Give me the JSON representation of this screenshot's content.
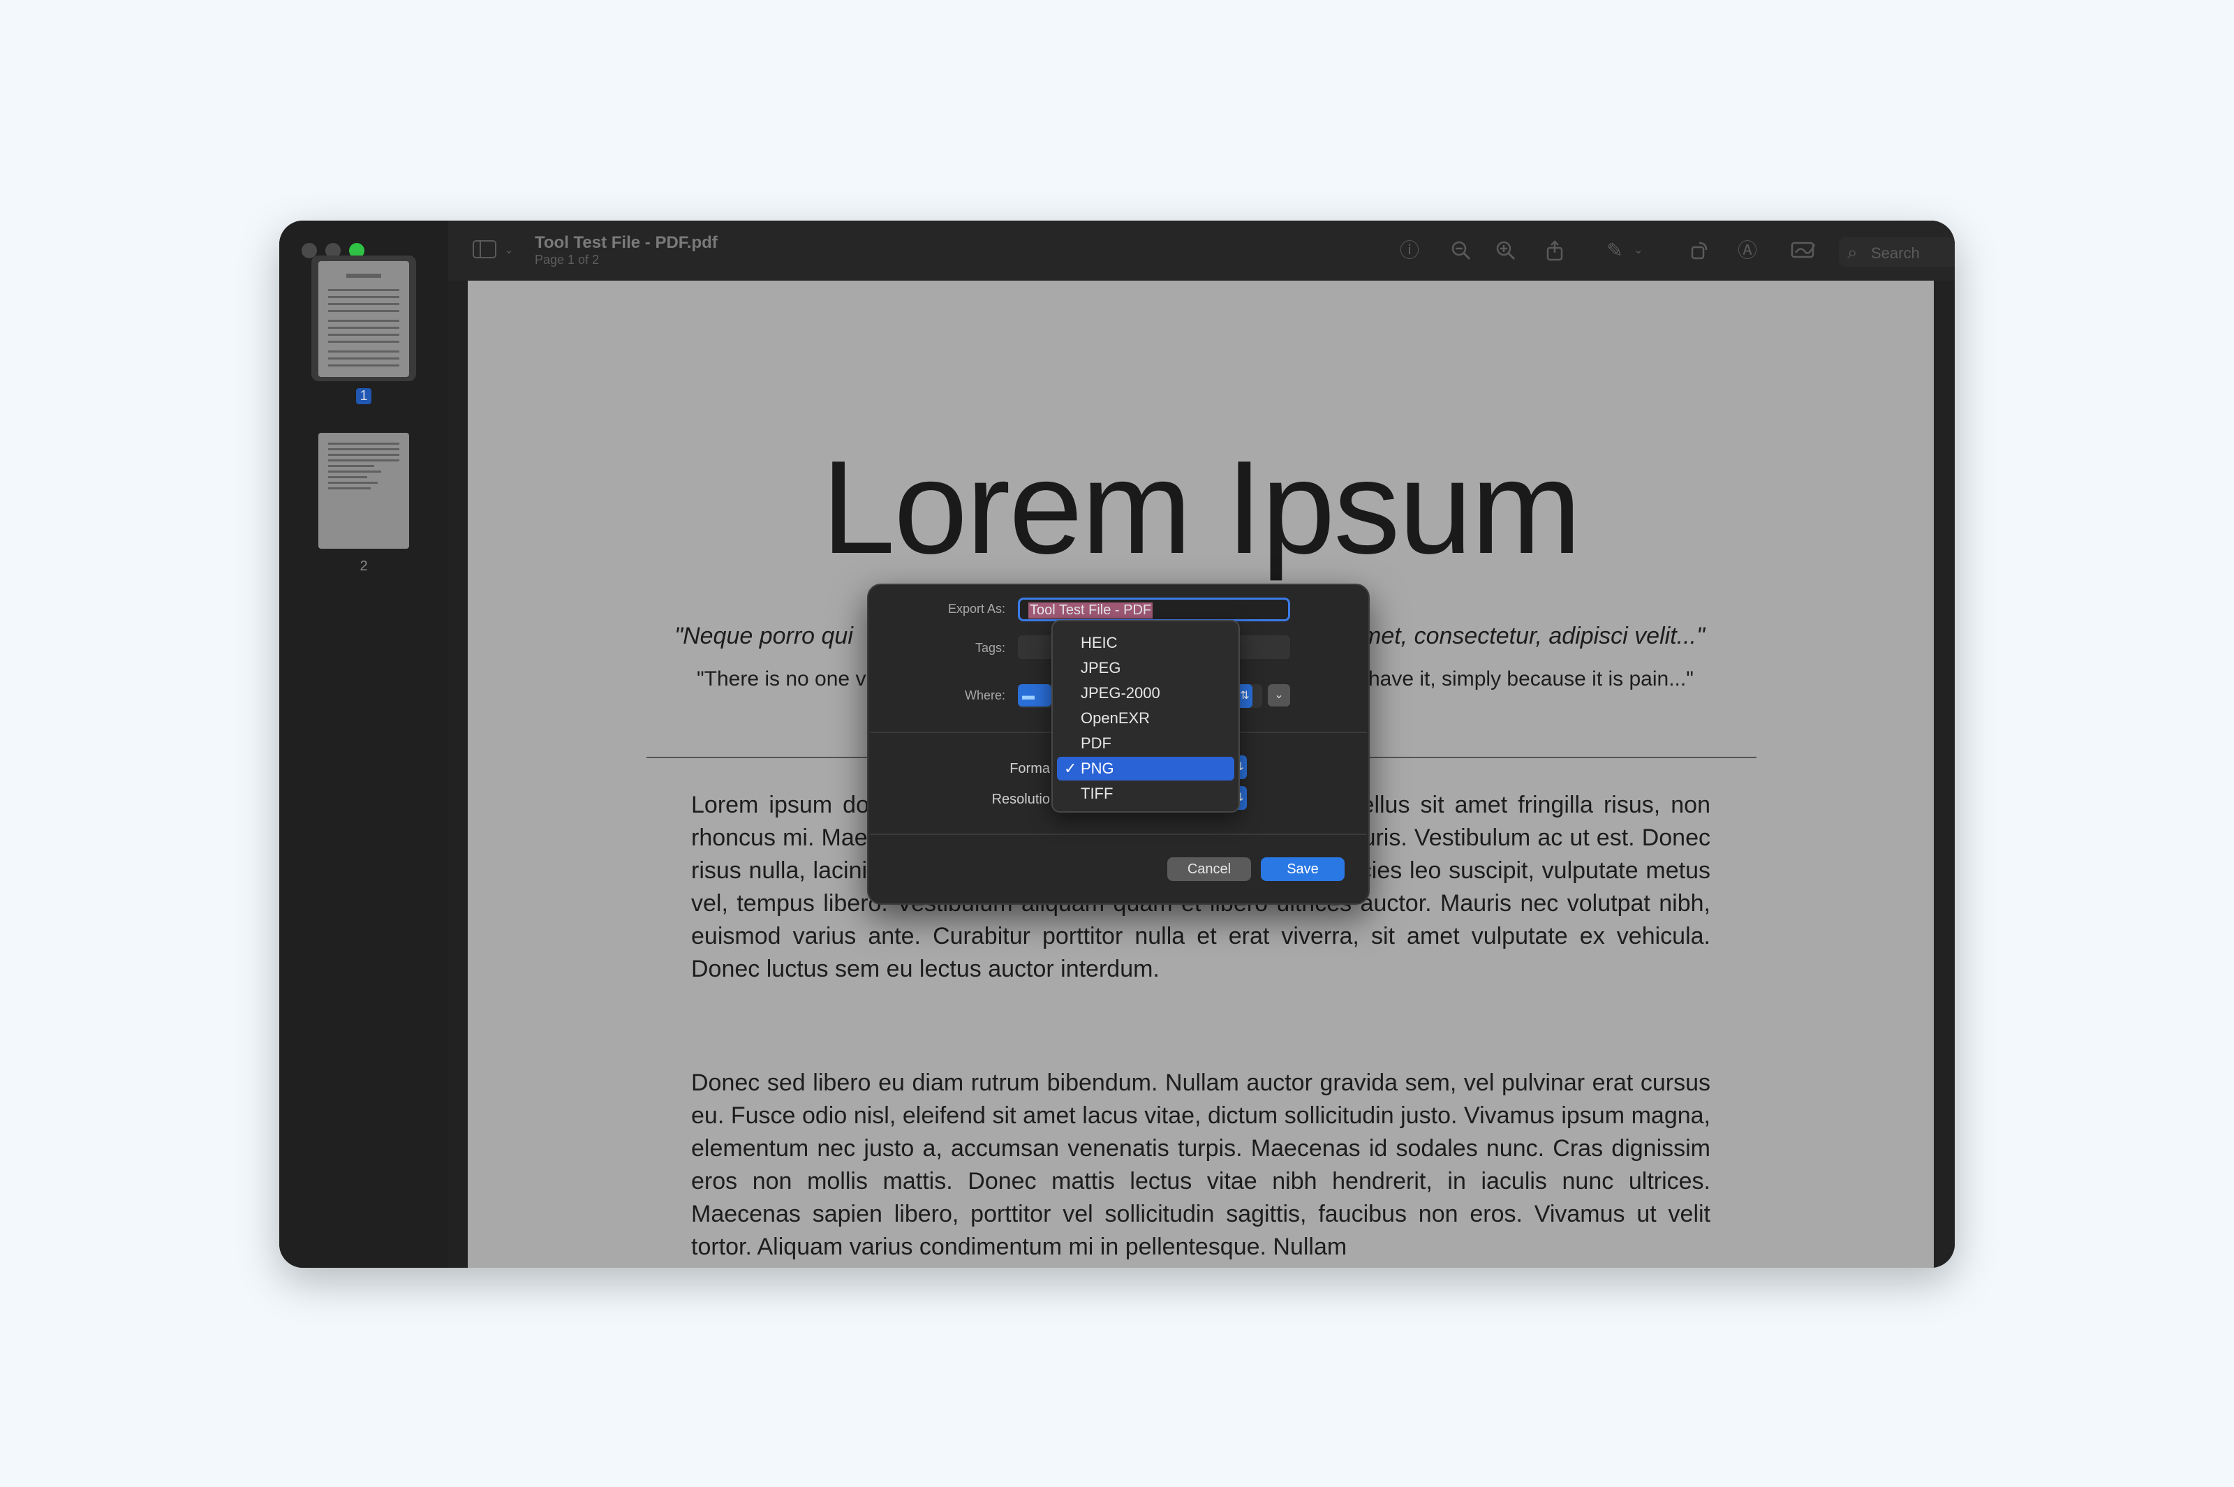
{
  "window": {
    "title": "Tool Test File - PDF.pdf",
    "subtitle": "Page 1 of 2"
  },
  "sidebar": {
    "pages": [
      {
        "label": "1",
        "selected": true
      },
      {
        "label": "2",
        "selected": false
      }
    ]
  },
  "toolbar": {
    "icons": [
      "sidebar-toggle-icon",
      "chevron-down-icon",
      "info-icon",
      "zoom-out-icon",
      "zoom-in-icon",
      "share-icon",
      "markup-pen-icon",
      "chevron-down-icon",
      "rotate-icon",
      "markup-circle-icon",
      "signature-icon"
    ],
    "search_placeholder": "Search"
  },
  "document": {
    "title": "Lorem Ipsum",
    "quote_left": "\"Neque porro qui",
    "quote_right": "met, consectetur, adipisci velit...\"",
    "quote2_left": "\"There is no one v",
    "quote2_right": "have it, simply because it is pain...\"",
    "paragraph1": "Lorem ipsum dolor sit amet, consectetur adipiscing elit. Phasellus sit amet fringilla risus, non rhoncus mi. Maecenas pharetra dui efficitur. Proin ut magna mauris. Vestibulum ac ut est. Donec risus nulla, lacinia ut rhoncus vel, posuere vel turpis. Morbi ultricies leo suscipit, vulputate metus vel, tempus libero. Vestibulum aliquam quam et libero ultrices auctor. Mauris nec volutpat nibh, euismod varius ante. Curabitur porttitor nulla et erat viverra, sit amet vulputate ex vehicula. Donec luctus sem eu lectus auctor interdum.",
    "paragraph2": "Donec sed libero eu diam rutrum bibendum. Nullam auctor gravida sem, vel pulvinar erat cursus eu. Fusce odio nisl, eleifend sit amet lacus vitae, dictum sollicitudin justo. Vivamus ipsum magna, elementum nec justo a, accumsan venenatis turpis. Maecenas id sodales nunc. Cras dignissim eros non mollis mattis. Donec mattis lectus vitae nibh hendrerit, in iaculis nunc ultrices. Maecenas sapien libero, porttitor vel sollicitudin sagittis, faucibus non eros. Vivamus ut velit tortor. Aliquam varius condimentum mi in pellentesque. Nullam"
  },
  "export_dialog": {
    "export_as_label": "Export As:",
    "export_as_value": "Tool Test File - PDF",
    "tags_label": "Tags:",
    "where_label": "Where:",
    "format_label": "Forma",
    "resolution_label": "Resolutio",
    "cancel_label": "Cancel",
    "save_label": "Save"
  },
  "format_menu": {
    "options": [
      "HEIC",
      "JPEG",
      "JPEG-2000",
      "OpenEXR",
      "PDF",
      "PNG",
      "TIFF"
    ],
    "selected": "PNG",
    "check": "✓"
  },
  "colors": {
    "accent": "#2a78e4",
    "selection": "#a05a76",
    "menu_highlight": "#2a63d6"
  }
}
